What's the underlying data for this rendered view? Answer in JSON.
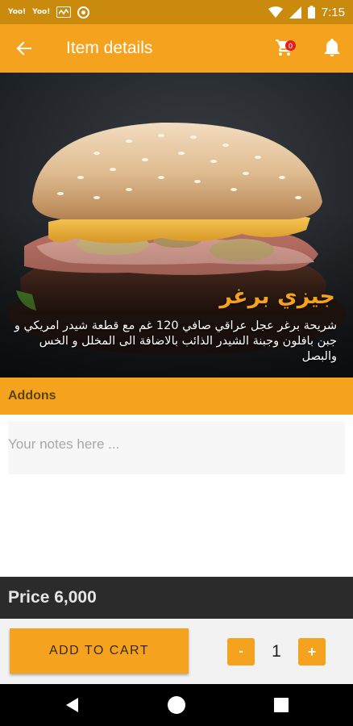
{
  "status_bar": {
    "time": "7:15",
    "icons": [
      "sim-icon",
      "sim-icon",
      "activity-icon",
      "record-icon",
      "wifi-icon",
      "signal-icon",
      "battery-icon"
    ],
    "sim_label_1": "Ⓜ",
    "sim_label_2": "Ⓜ"
  },
  "app_bar": {
    "title": "Item details",
    "cart_count": "0",
    "colors": {
      "background": "#f5a31e",
      "status_bar": "#c98a0e",
      "badge": "#e02020"
    }
  },
  "item": {
    "name": "جيزي برغر",
    "description": "شريحة برغر عجل عراقي صافي 120 غم  مع قطعة شيدر امريكي و جبن بافلون وجبنة الشيدر الذائب بالاضافة الى المخلل و الخس والبصل"
  },
  "addons": {
    "label": "Addons"
  },
  "notes": {
    "placeholder": "Your notes here ..."
  },
  "price": {
    "text": "Price 6,000"
  },
  "cart_controls": {
    "add_label": "ADD TO CART",
    "minus_label": "-",
    "quantity": "1",
    "plus_label": "+"
  }
}
